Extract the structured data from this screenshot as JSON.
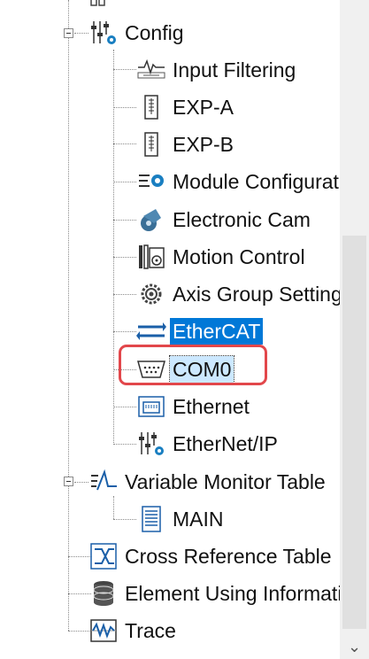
{
  "tree": {
    "config": {
      "label": "Config"
    },
    "config_children": [
      {
        "label": "Input Filtering",
        "icon": "waveform-icon"
      },
      {
        "label": "EXP-A",
        "icon": "expansion-module-icon"
      },
      {
        "label": "EXP-B",
        "icon": "expansion-module-icon"
      },
      {
        "label": "Module Configuration",
        "icon": "module-config-icon"
      },
      {
        "label": "Electronic Cam",
        "icon": "cam-icon"
      },
      {
        "label": "Motion Control",
        "icon": "motion-control-icon"
      },
      {
        "label": "Axis Group Setting",
        "icon": "axis-group-gear-icon"
      },
      {
        "label": "EtherCAT",
        "icon": "ethercat-arrows-icon"
      },
      {
        "label": "COM0",
        "icon": "serial-port-icon"
      },
      {
        "label": "Ethernet",
        "icon": "ethernet-port-icon"
      },
      {
        "label": "EtherNet/IP",
        "icon": "ethernet-ip-icon"
      }
    ],
    "variable_monitor": {
      "label": "Variable Monitor Table"
    },
    "variable_monitor_children": [
      {
        "label": "MAIN"
      }
    ],
    "cross_reference": {
      "label": "Cross Reference Table"
    },
    "element_using": {
      "label": "Element Using Information"
    },
    "trace": {
      "label": "Trace"
    }
  },
  "colors": {
    "selection": "#0078d7",
    "highlight_box": "#e2474b"
  }
}
